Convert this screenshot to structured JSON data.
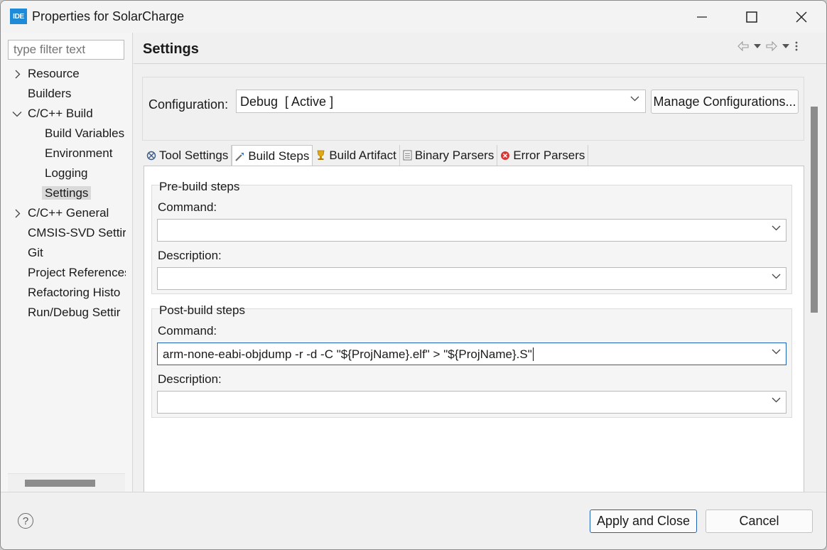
{
  "window": {
    "app_icon_text": "IDE",
    "title": "Properties for SolarCharge"
  },
  "left": {
    "filter_placeholder": "type filter text",
    "tree": [
      {
        "label": "Resource",
        "expandable": true,
        "expanded": false
      },
      {
        "label": "Builders"
      },
      {
        "label": "C/C++ Build",
        "expandable": true,
        "expanded": true
      },
      {
        "label": "Build Variables"
      },
      {
        "label": "Environment"
      },
      {
        "label": "Logging"
      },
      {
        "label": "Settings",
        "selected": true
      },
      {
        "label": "C/C++ General",
        "expandable": true,
        "expanded": false
      },
      {
        "label": "CMSIS-SVD Settir"
      },
      {
        "label": "Git"
      },
      {
        "label": "Project References"
      },
      {
        "label": "Refactoring Histo"
      },
      {
        "label": "Run/Debug Settir"
      }
    ]
  },
  "right": {
    "title": "Settings",
    "configuration_label": "Configuration:",
    "configuration_value": "Debug  [ Active ]",
    "manage_button": "Manage Configurations...",
    "tabs": [
      {
        "label": "Tool Settings",
        "icon": "tool-settings-icon"
      },
      {
        "label": "Build Steps",
        "icon": "build-steps-icon",
        "active": true
      },
      {
        "label": "Build Artifact",
        "icon": "build-artifact-icon"
      },
      {
        "label": "Binary Parsers",
        "icon": "binary-parsers-icon"
      },
      {
        "label": "Error Parsers",
        "icon": "error-parsers-icon"
      }
    ],
    "pre_build": {
      "title": "Pre-build steps",
      "command_label": "Command:",
      "command_value": "",
      "description_label": "Description:",
      "description_value": ""
    },
    "post_build": {
      "title": "Post-build steps",
      "command_label": "Command:",
      "command_value": "arm-none-eabi-objdump -r -d -C \"${ProjName}.elf\" > \"${ProjName}.S\"",
      "description_label": "Description:",
      "description_value": ""
    }
  },
  "footer": {
    "help_symbol": "?",
    "apply_close": "Apply and Close",
    "cancel": "Cancel"
  },
  "colors": {
    "accent": "#1f63b5",
    "app_icon": "#1f8bd8",
    "error_icon": "#d93636"
  }
}
